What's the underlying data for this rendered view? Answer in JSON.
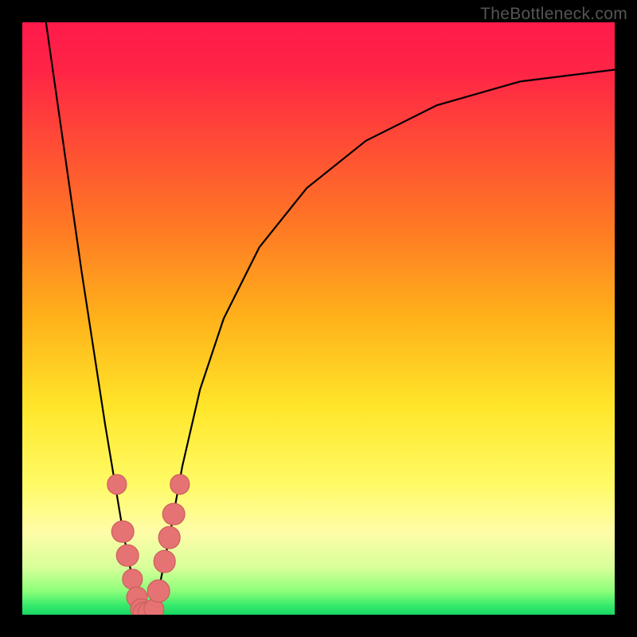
{
  "watermark": "TheBottleneck.com",
  "colors": {
    "frame": "#000000",
    "curve": "#000000",
    "dot_fill": "#e57373",
    "dot_stroke": "#c85a5a"
  },
  "gradient_stops": [
    {
      "offset": 0.0,
      "color": "#ff1a4b"
    },
    {
      "offset": 0.08,
      "color": "#ff2446"
    },
    {
      "offset": 0.2,
      "color": "#ff4a36"
    },
    {
      "offset": 0.35,
      "color": "#ff7a24"
    },
    {
      "offset": 0.5,
      "color": "#ffb21a"
    },
    {
      "offset": 0.65,
      "color": "#ffe62a"
    },
    {
      "offset": 0.78,
      "color": "#fffb66"
    },
    {
      "offset": 0.86,
      "color": "#fffca8"
    },
    {
      "offset": 0.92,
      "color": "#d8ff9a"
    },
    {
      "offset": 0.96,
      "color": "#8dff7a"
    },
    {
      "offset": 0.985,
      "color": "#35e96b"
    },
    {
      "offset": 1.0,
      "color": "#17d862"
    }
  ],
  "chart_data": {
    "type": "line",
    "title": "",
    "xlabel": "",
    "ylabel": "",
    "xlim": [
      0,
      100
    ],
    "ylim": [
      0,
      100
    ],
    "grid": false,
    "legend": false,
    "series": [
      {
        "name": "bottleneck-curve",
        "x": [
          4,
          6,
          8,
          10,
          12,
          14,
          16,
          17,
          18,
          19,
          20,
          21,
          22,
          23,
          24,
          25,
          27,
          30,
          34,
          40,
          48,
          58,
          70,
          84,
          100
        ],
        "y": [
          100,
          86,
          72,
          58,
          45,
          32,
          20,
          14,
          9,
          4,
          1,
          0,
          1,
          4,
          9,
          14,
          25,
          38,
          50,
          62,
          72,
          80,
          86,
          90,
          92
        ]
      }
    ],
    "data_points": [
      {
        "x": 16.0,
        "y": 22,
        "r": 2.0
      },
      {
        "x": 17.0,
        "y": 14,
        "r": 2.4
      },
      {
        "x": 17.8,
        "y": 10,
        "r": 2.4
      },
      {
        "x": 18.6,
        "y": 6,
        "r": 2.0
      },
      {
        "x": 19.3,
        "y": 3,
        "r": 2.2
      },
      {
        "x": 20.0,
        "y": 1,
        "r": 2.2
      },
      {
        "x": 20.6,
        "y": 0.3,
        "r": 2.4
      },
      {
        "x": 21.4,
        "y": 0.3,
        "r": 2.4
      },
      {
        "x": 22.2,
        "y": 1,
        "r": 2.0
      },
      {
        "x": 23.0,
        "y": 4,
        "r": 2.4
      },
      {
        "x": 24.0,
        "y": 9,
        "r": 2.4
      },
      {
        "x": 24.8,
        "y": 13,
        "r": 2.4
      },
      {
        "x": 25.6,
        "y": 17,
        "r": 2.4
      },
      {
        "x": 26.6,
        "y": 22,
        "r": 2.0
      }
    ],
    "annotations": [
      {
        "text": "TheBottleneck.com",
        "position": "top-right"
      }
    ]
  }
}
